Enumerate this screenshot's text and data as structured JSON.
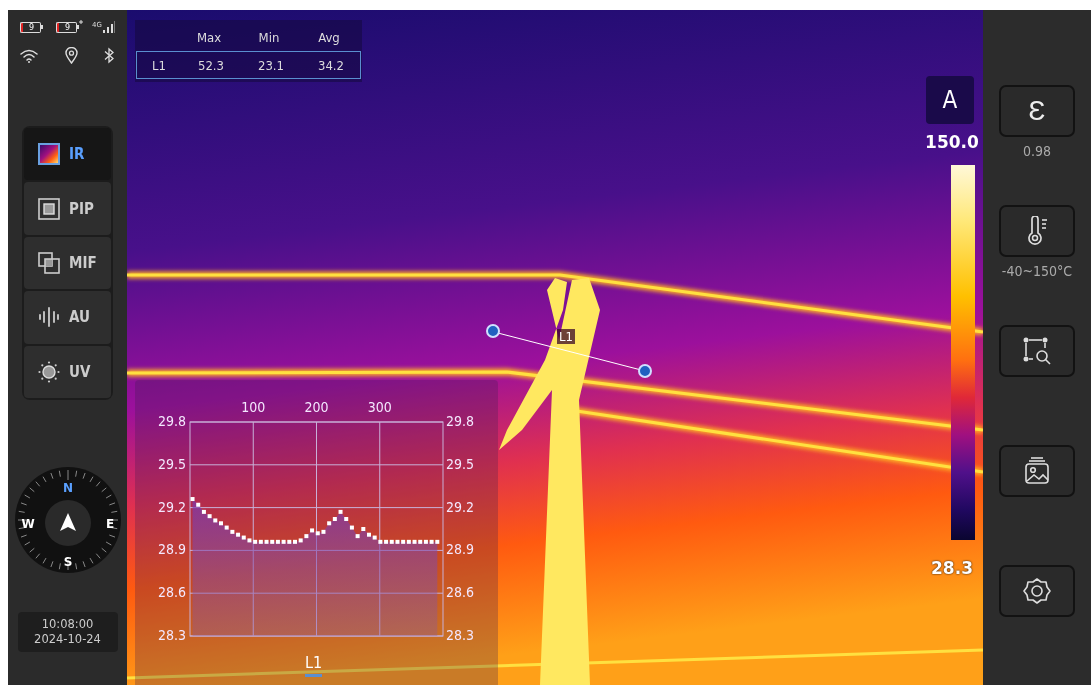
{
  "status_bar": {
    "batteries": [
      {
        "label": "9",
        "charging": false
      },
      {
        "label": "9",
        "charging": true
      }
    ],
    "network": "4G"
  },
  "measurement_table": {
    "columns": [
      "Max",
      "Min",
      "Avg"
    ],
    "rows": [
      {
        "name": "L1",
        "cells": [
          "52.3",
          "23.1",
          "34.2"
        ],
        "selected": true
      }
    ]
  },
  "modes": [
    {
      "label": "IR",
      "kind": "palette",
      "selected": true
    },
    {
      "label": "PIP",
      "kind": "pip",
      "selected": false
    },
    {
      "label": "MIF",
      "kind": "mif",
      "selected": false
    },
    {
      "label": "AU",
      "kind": "audio",
      "selected": false
    },
    {
      "label": "UV",
      "kind": "sun",
      "selected": false
    }
  ],
  "compass": {
    "directions": [
      {
        "label": "N",
        "highlighted": true
      },
      {
        "label": "W",
        "highlighted": false
      },
      {
        "label": "E",
        "highlighted": false
      },
      {
        "label": "S",
        "highlighted": false
      }
    ]
  },
  "datetime": {
    "time": "10:08:00",
    "date": "2024-10-24"
  },
  "measure_line": {
    "label": "L1"
  },
  "profile_chart": {
    "left_axis_labels": [
      "29.8",
      "29.5",
      "29.2",
      "28.9",
      "28.6",
      "28.3"
    ],
    "right_axis_labels": [
      "29.8",
      "29.5",
      "29.2",
      "28.9",
      "28.6",
      "28.3"
    ],
    "chart_data": {
      "type": "area",
      "grid": true,
      "xlim": [
        0,
        400
      ],
      "ylim": [
        28.3,
        29.8
      ],
      "xticks": [
        100,
        200,
        300
      ],
      "yticks": [
        29.8,
        29.5,
        29.2,
        28.9,
        28.6,
        28.3
      ],
      "x": [
        4,
        13,
        22,
        31,
        40,
        49,
        58,
        67,
        76,
        85,
        94,
        103,
        112,
        121,
        130,
        139,
        148,
        157,
        166,
        175,
        184,
        193,
        202,
        211,
        220,
        229,
        238,
        247,
        256,
        265,
        274,
        283,
        292,
        301,
        310,
        319,
        328,
        337,
        346,
        355,
        364,
        373,
        382,
        391
      ],
      "series": [
        {
          "name": "L1",
          "color": "#ffffff",
          "values": [
            29.26,
            29.22,
            29.17,
            29.14,
            29.11,
            29.09,
            29.06,
            29.03,
            29.01,
            28.99,
            28.97,
            28.96,
            28.96,
            28.96,
            28.96,
            28.96,
            28.96,
            28.96,
            28.96,
            28.97,
            29.0,
            29.04,
            29.02,
            29.03,
            29.09,
            29.12,
            29.17,
            29.12,
            29.06,
            29.0,
            29.05,
            29.01,
            28.99,
            28.96,
            28.96,
            28.96,
            28.96,
            28.96,
            28.96,
            28.96,
            28.96,
            28.96,
            28.96,
            28.96
          ]
        }
      ]
    }
  },
  "palette_scale": {
    "mode": "A",
    "max": "150.0",
    "min": "28.3"
  },
  "tools": [
    {
      "kind": "emissivity",
      "symbol": "Ɛ",
      "reading": "0.98"
    },
    {
      "kind": "range",
      "reading": "-40~150°C"
    },
    {
      "kind": "region"
    },
    {
      "kind": "gallery"
    },
    {
      "kind": "settings"
    }
  ]
}
